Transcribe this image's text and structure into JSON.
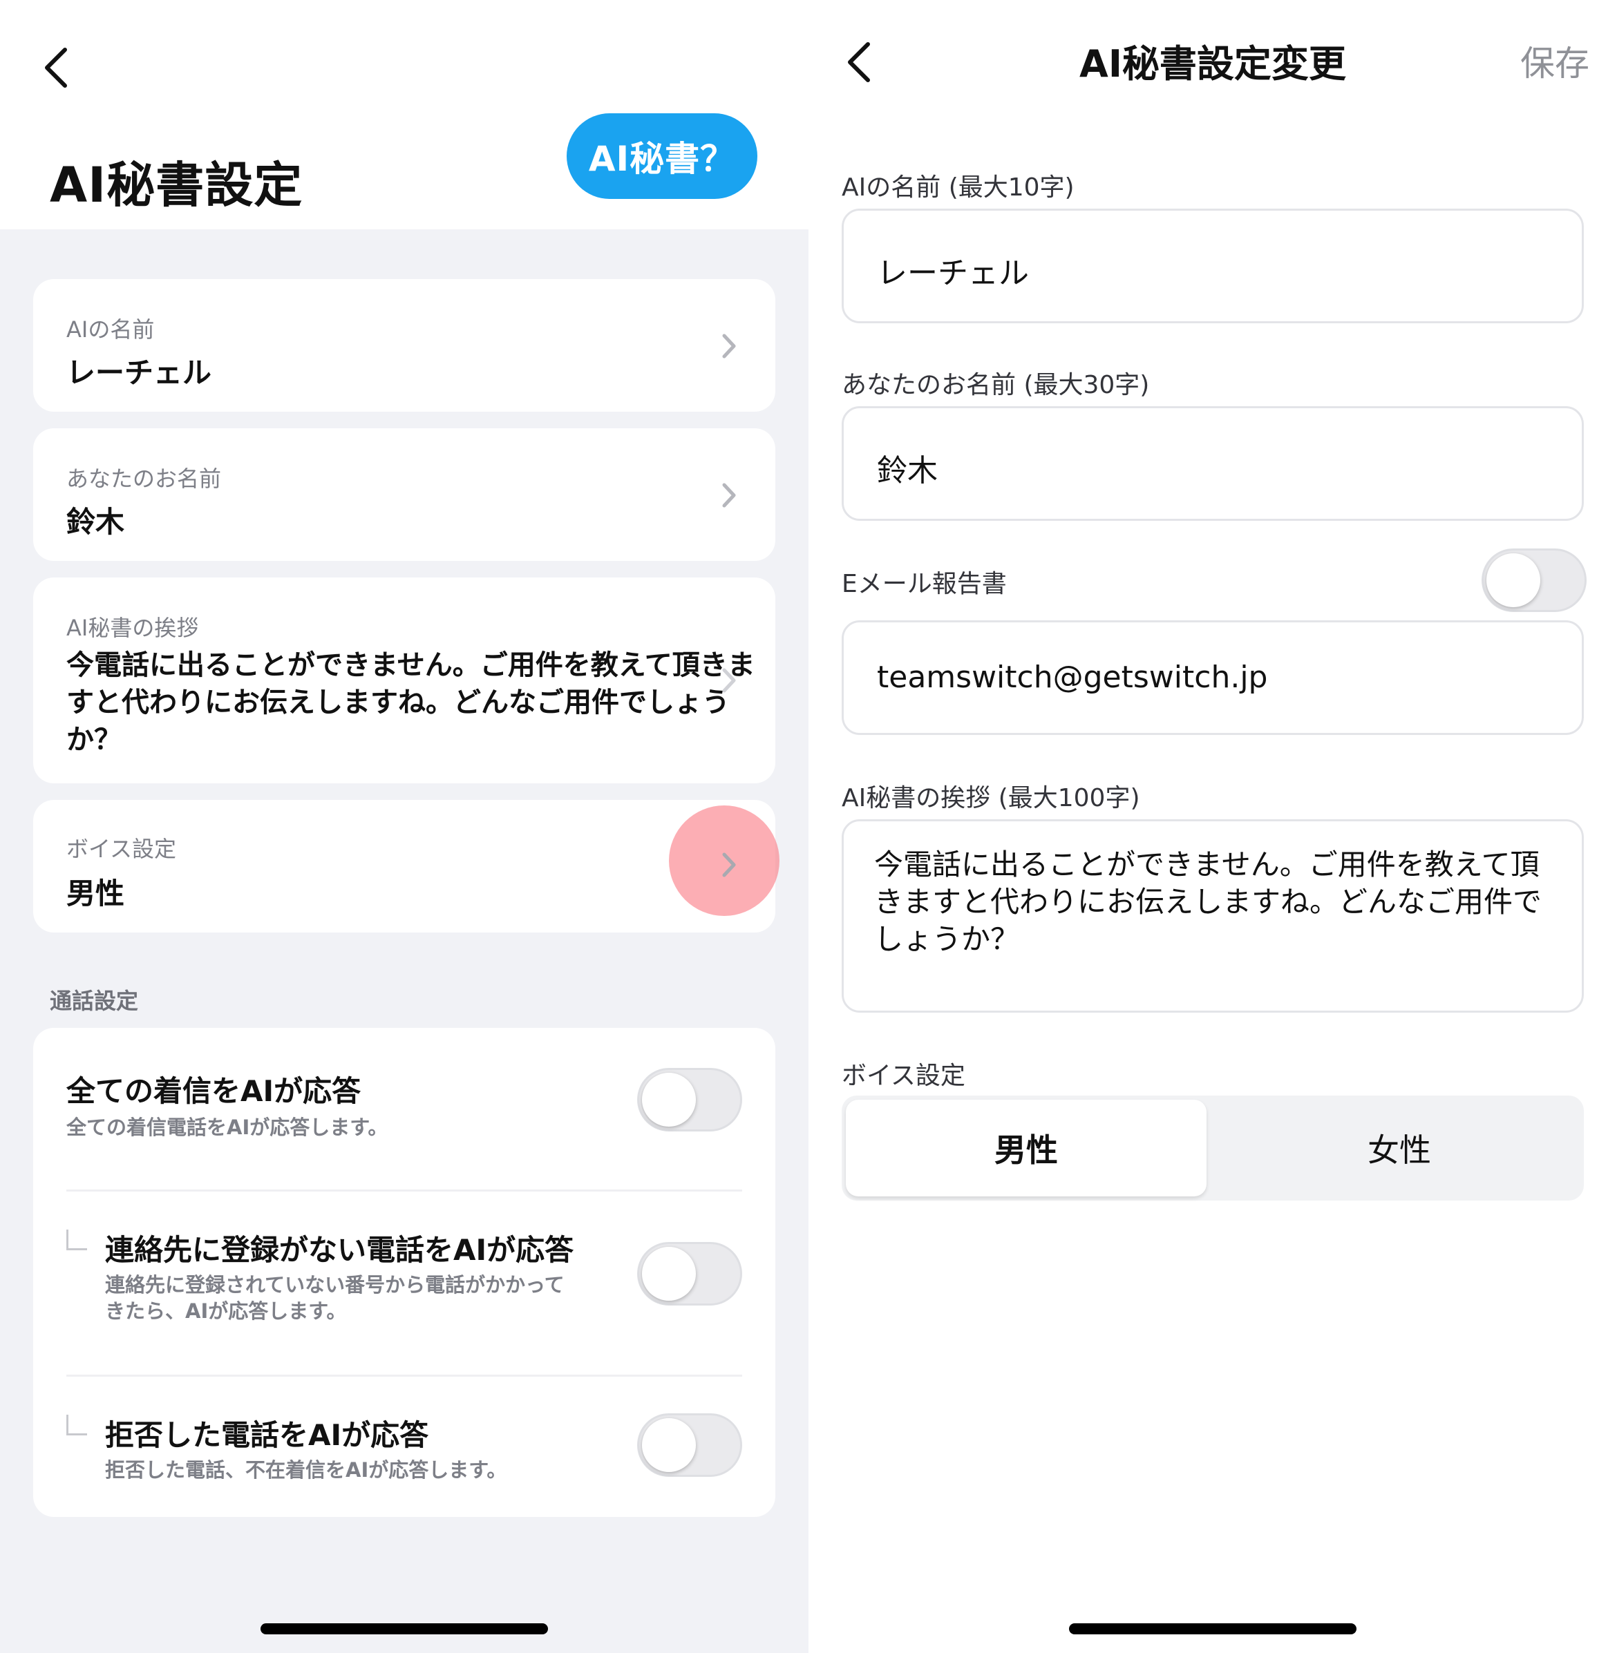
{
  "left": {
    "title": "AI秘書設定",
    "ai_help_button": "AI秘書？",
    "items": [
      {
        "label": "AIの名前",
        "value": "レーチェル"
      },
      {
        "label": "あなたのお名前",
        "value": "鈴木"
      },
      {
        "label": "AI秘書の挨拶",
        "value": "今電話に出ることができません。ご用件を教えて頂きますと代わりにお伝えしますね。どんなご用件でしょうか？"
      },
      {
        "label": "ボイス設定",
        "value": "男性"
      }
    ],
    "call_section_label": "通話設定",
    "call_settings": [
      {
        "title": "全ての着信をAIが応答",
        "desc": "全ての着信電話をAIが応答します。",
        "on": false
      },
      {
        "title": "連絡先に登録がない電話をAIが応答",
        "desc_line1": "連絡先に登録されていない番号から電話がかかって",
        "desc_line2": "きたら、AIが応答します。",
        "on": false
      },
      {
        "title": "拒否した電話をAIが応答",
        "desc": "拒否した電話、不在着信をAIが応答します。",
        "on": false
      }
    ]
  },
  "right": {
    "title": "AI秘書設定変更",
    "save_label": "保存",
    "ai_name": {
      "label": "AIの名前 (最大10字)",
      "value": "レーチェル"
    },
    "user_name": {
      "label": "あなたのお名前 (最大30字)",
      "value": "鈴木"
    },
    "email_report": {
      "label": "Eメール報告書",
      "value": "teamswitch@getswitch.jp",
      "on": false
    },
    "greeting": {
      "label": "AI秘書の挨拶 (最大100字)",
      "value": "今電話に出ることができません。ご用件を教えて頂きますと代わりにお伝えしますね。どんなご用件でしょうか？"
    },
    "voice": {
      "label": "ボイス設定",
      "options": [
        "男性",
        "女性"
      ],
      "selected": "男性"
    }
  },
  "colors": {
    "accent_blue": "#1aa3f0",
    "screen_bg": "#f1f2f6",
    "tap_highlight": "#fa7882"
  }
}
